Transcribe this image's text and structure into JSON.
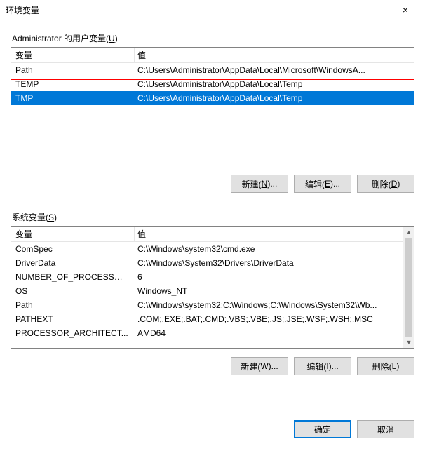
{
  "title": "环境变量",
  "close_glyph": "×",
  "user_section": {
    "label_prefix": "Administrator 的用户变量(",
    "label_hotkey": "U",
    "label_suffix": ")",
    "header_var": "变量",
    "header_val": "值",
    "rows": [
      {
        "name": "Path",
        "value": "C:\\Users\\Administrator\\AppData\\Local\\Microsoft\\WindowsA...",
        "selected": false
      },
      {
        "name": "TEMP",
        "value": "C:\\Users\\Administrator\\AppData\\Local\\Temp",
        "selected": false
      },
      {
        "name": "TMP",
        "value": "C:\\Users\\Administrator\\AppData\\Local\\Temp",
        "selected": true
      }
    ],
    "buttons": {
      "new": {
        "text": "新建(",
        "hot": "N",
        "tail": ")..."
      },
      "edit": {
        "text": "编辑(",
        "hot": "E",
        "tail": ")..."
      },
      "delete": {
        "text": "删除(",
        "hot": "D",
        "tail": ")"
      }
    }
  },
  "system_section": {
    "label_prefix": "系统变量(",
    "label_hotkey": "S",
    "label_suffix": ")",
    "header_var": "变量",
    "header_val": "值",
    "rows": [
      {
        "name": "ComSpec",
        "value": "C:\\Windows\\system32\\cmd.exe"
      },
      {
        "name": "DriverData",
        "value": "C:\\Windows\\System32\\Drivers\\DriverData"
      },
      {
        "name": "NUMBER_OF_PROCESSORS",
        "value": "6"
      },
      {
        "name": "OS",
        "value": "Windows_NT"
      },
      {
        "name": "Path",
        "value": "C:\\Windows\\system32;C:\\Windows;C:\\Windows\\System32\\Wb..."
      },
      {
        "name": "PATHEXT",
        "value": ".COM;.EXE;.BAT;.CMD;.VBS;.VBE;.JS;.JSE;.WSF;.WSH;.MSC"
      },
      {
        "name": "PROCESSOR_ARCHITECT...",
        "value": "AMD64"
      }
    ],
    "buttons": {
      "new": {
        "text": "新建(",
        "hot": "W",
        "tail": ")..."
      },
      "edit": {
        "text": "编辑(",
        "hot": "I",
        "tail": ")..."
      },
      "delete": {
        "text": "删除(",
        "hot": "L",
        "tail": ")"
      }
    }
  },
  "dialog_buttons": {
    "ok": "确定",
    "cancel": "取消"
  },
  "scroll_glyphs": {
    "up": "▲",
    "down": "▼"
  }
}
